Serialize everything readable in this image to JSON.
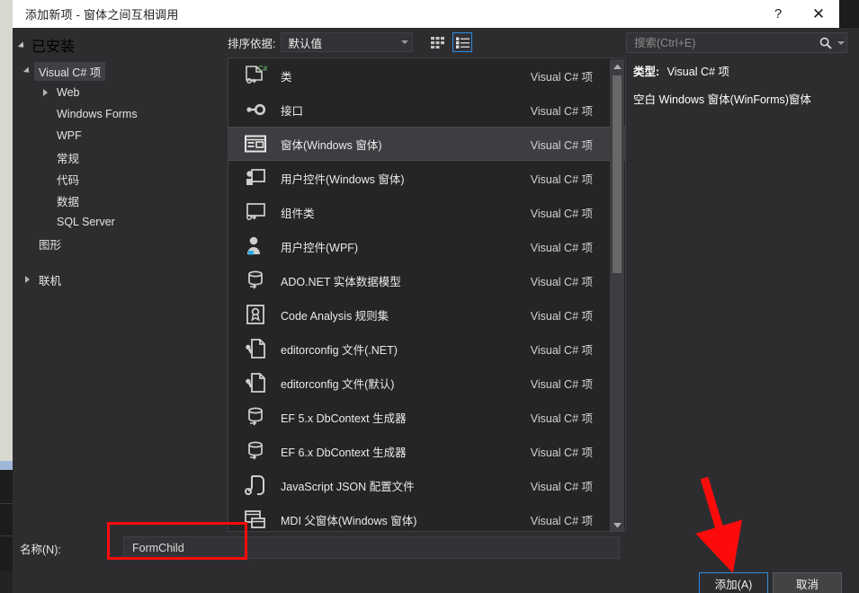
{
  "window": {
    "title": "添加新项 - 窗体之间互相调用",
    "help_label": "?",
    "close_label": "✕"
  },
  "toolbar": {
    "installed_label": "已安装",
    "sort_label": "排序依据:",
    "sort_value": "默认值",
    "view_grid_icon": "grid-view-icon",
    "view_list_icon": "list-view-icon",
    "search_placeholder": "搜索(Ctrl+E)",
    "search_value": "",
    "search_icon": "search-icon",
    "search_dropdown_icon": "chevron-down-icon"
  },
  "tree": {
    "nodes": [
      {
        "label": "Visual C# 项",
        "depth": 0,
        "expander": "down",
        "selected": true
      },
      {
        "label": "Web",
        "depth": 1,
        "expander": "right",
        "selected": false
      },
      {
        "label": "Windows Forms",
        "depth": 1,
        "expander": "none",
        "selected": false
      },
      {
        "label": "WPF",
        "depth": 1,
        "expander": "none",
        "selected": false
      },
      {
        "label": "常规",
        "depth": 1,
        "expander": "none",
        "selected": false
      },
      {
        "label": "代码",
        "depth": 1,
        "expander": "none",
        "selected": false
      },
      {
        "label": "数据",
        "depth": 1,
        "expander": "none",
        "selected": false
      },
      {
        "label": "SQL Server",
        "depth": 1,
        "expander": "none",
        "selected": false
      },
      {
        "label": "图形",
        "depth": 0,
        "expander": "none",
        "selected": false
      },
      {
        "label": "联机",
        "depth": 0,
        "expander": "right",
        "selected": false,
        "spaced": true
      }
    ]
  },
  "item_list": {
    "kind_label": "Visual C# 项",
    "items": [
      {
        "label": "类",
        "kind": "Visual C# 项",
        "icon": "class-file-icon",
        "selected": false
      },
      {
        "label": "接口",
        "kind": "Visual C# 项",
        "icon": "interface-icon",
        "selected": false
      },
      {
        "label": "窗体(Windows 窗体)",
        "kind": "Visual C# 项",
        "icon": "windows-form-icon",
        "selected": true
      },
      {
        "label": "用户控件(Windows 窗体)",
        "kind": "Visual C# 项",
        "icon": "user-control-icon",
        "selected": false
      },
      {
        "label": "组件类",
        "kind": "Visual C# 项",
        "icon": "component-class-icon",
        "selected": false
      },
      {
        "label": "用户控件(WPF)",
        "kind": "Visual C# 项",
        "icon": "wpf-user-control-icon",
        "selected": false
      },
      {
        "label": "ADO.NET 实体数据模型",
        "kind": "Visual C# 项",
        "icon": "database-model-icon",
        "selected": false
      },
      {
        "label": "Code Analysis 规则集",
        "kind": "Visual C# 项",
        "icon": "ruleset-icon",
        "selected": false
      },
      {
        "label": "editorconfig 文件(.NET)",
        "kind": "Visual C# 项",
        "icon": "config-file-icon",
        "selected": false
      },
      {
        "label": "editorconfig 文件(默认)",
        "kind": "Visual C# 项",
        "icon": "config-file-icon",
        "selected": false
      },
      {
        "label": "EF 5.x DbContext 生成器",
        "kind": "Visual C# 项",
        "icon": "database-model-icon",
        "selected": false
      },
      {
        "label": "EF 6.x DbContext 生成器",
        "kind": "Visual C# 项",
        "icon": "database-model-icon",
        "selected": false
      },
      {
        "label": "JavaScript JSON 配置文件",
        "kind": "Visual C# 项",
        "icon": "json-file-icon",
        "selected": false
      },
      {
        "label": "MDI 父窗体(Windows 窗体)",
        "kind": "Visual C# 项",
        "icon": "mdi-form-icon",
        "selected": false
      }
    ]
  },
  "details": {
    "type_label": "类型:",
    "type_value": "Visual C# 项",
    "description": "空白 Windows 窗体(WinForms)窗体"
  },
  "name_field": {
    "label": "名称(N):",
    "value": "FormChild"
  },
  "footer": {
    "add_label": "添加(A)",
    "cancel_label": "取消"
  },
  "annotations": {
    "highlight_color": "#fd0b0b",
    "focus_color": "#2e8ce0"
  }
}
